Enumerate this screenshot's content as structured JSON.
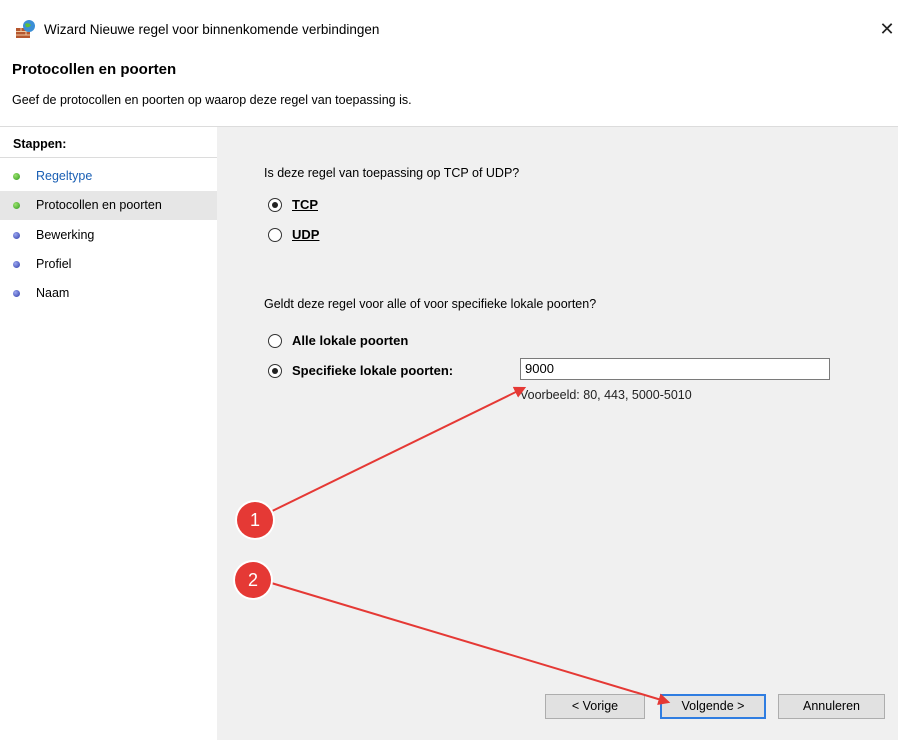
{
  "window": {
    "title": "Wizard Nieuwe regel voor binnenkomende verbindingen",
    "close_symbol": "✕"
  },
  "header": {
    "title": "Protocollen en poorten",
    "description": "Geef de protocollen en poorten op waarop deze regel van toepassing is."
  },
  "sidebar": {
    "heading": "Stappen:",
    "items": [
      {
        "label": "Regeltype",
        "status": "completed"
      },
      {
        "label": "Protocollen en poorten",
        "status": "current"
      },
      {
        "label": "Bewerking",
        "status": "pending"
      },
      {
        "label": "Profiel",
        "status": "pending"
      },
      {
        "label": "Naam",
        "status": "pending"
      }
    ]
  },
  "main": {
    "protocol_question": "Is deze regel van toepassing op TCP of UDP?",
    "protocol_options": [
      {
        "label": "TCP",
        "selected": true
      },
      {
        "label": "UDP",
        "selected": false
      }
    ],
    "ports_question": "Geldt deze regel voor alle of voor specifieke lokale poorten?",
    "ports_options": [
      {
        "label": "Alle lokale poorten",
        "selected": false
      },
      {
        "label": "Specifieke lokale poorten:",
        "selected": true
      }
    ],
    "port_value": "9000",
    "example_text": "Voorbeeld: 80, 443, 5000-5010"
  },
  "buttons": {
    "back": "< Vorige",
    "next": "Volgende >",
    "cancel": "Annuleren"
  },
  "annotations": {
    "badge_1": "1",
    "badge_2": "2",
    "arrow_color": "#e53935"
  },
  "colors": {
    "accent": "#2f7de1",
    "link": "#1a5fb4",
    "panel": "#f0f0f0"
  },
  "icons": {
    "window_icon": "firewall-icon",
    "close_icon": "close-icon"
  }
}
